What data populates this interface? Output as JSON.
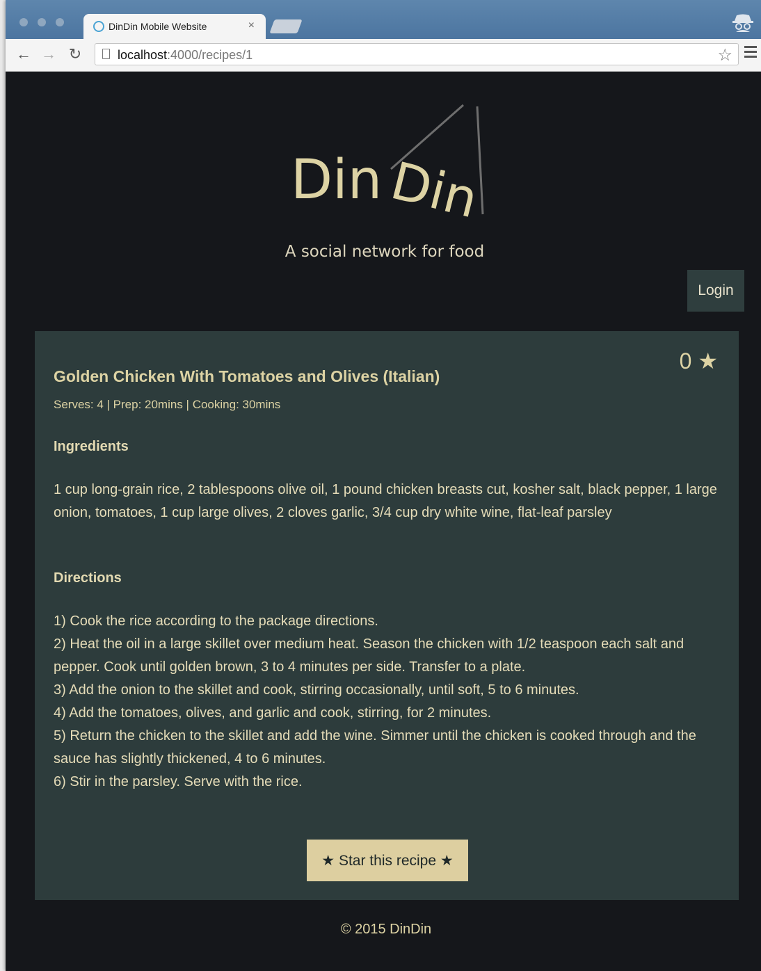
{
  "browser": {
    "tab_title": "DinDin Mobile Website",
    "tab_close": "×",
    "url_host": "localhost",
    "url_path": ":4000/recipes/1"
  },
  "site": {
    "logo_text_1": "Din",
    "logo_text_2": "Din",
    "tagline": "A social network for food",
    "login_label": "Login"
  },
  "recipe": {
    "rating": "0 ★",
    "title": "Golden Chicken With Tomatoes and Olives (Italian)",
    "meta": "Serves: 4 | Prep: 20mins | Cooking: 30mins",
    "ingredients_heading": "Ingredients",
    "ingredients": "1 cup long-grain rice, 2 tablespoons olive oil, 1 pound chicken breasts cut, kosher salt, black pepper, 1 large onion, tomatoes, 1 cup large olives, 2 cloves garlic, 3/4 cup dry white wine, flat-leaf parsley",
    "directions_heading": "Directions",
    "directions": [
      "1) Cook the rice according to the package directions.",
      "2) Heat the oil in a large skillet over medium heat. Season the chicken with 1/2 teaspoon each salt and pepper. Cook until golden brown, 3 to 4 minutes per side. Transfer to a plate.",
      "3) Add the onion to the skillet and cook, stirring occasionally, until soft, 5 to 6 minutes.",
      "4) Add the tomatoes, olives, and garlic and cook, stirring, for 2 minutes.",
      "5) Return the chicken to the skillet and add the wine. Simmer until the chicken is cooked through and the sauce has slightly thickened, 4 to 6 minutes.",
      "6) Stir in the parsley. Serve with the rice."
    ],
    "star_button_label": "★ Star this recipe ★"
  },
  "footer": {
    "copyright": "© 2015 DinDin"
  },
  "colors": {
    "page_bg": "#15171b",
    "card_bg": "#2d3c3c",
    "accent_text": "#ddd3a4",
    "button_bg": "#ddcfa0"
  }
}
